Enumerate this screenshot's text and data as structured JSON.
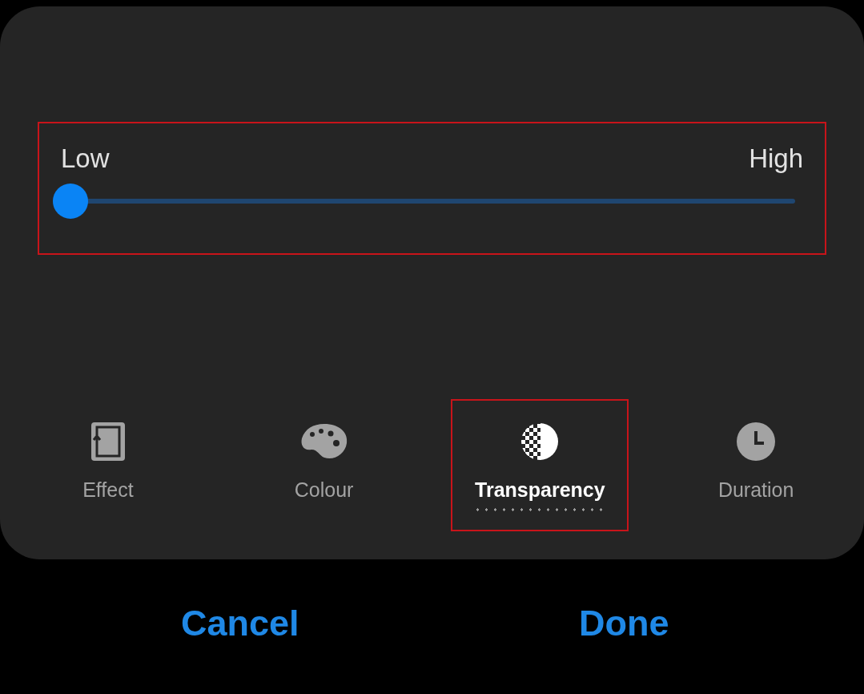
{
  "slider": {
    "min_label": "Low",
    "max_label": "High",
    "level": 0,
    "highlighted": true
  },
  "tabs": [
    {
      "kind": "effect",
      "label": "Effect",
      "selected": false,
      "highlighted": false
    },
    {
      "kind": "colour",
      "label": "Colour",
      "selected": false,
      "highlighted": false
    },
    {
      "kind": "transparency",
      "label": "Transparency",
      "selected": true,
      "highlighted": true
    },
    {
      "kind": "duration",
      "label": "Duration",
      "selected": false,
      "highlighted": false
    }
  ],
  "buttons": [
    {
      "label": "Cancel"
    },
    {
      "label": "Done"
    }
  ]
}
